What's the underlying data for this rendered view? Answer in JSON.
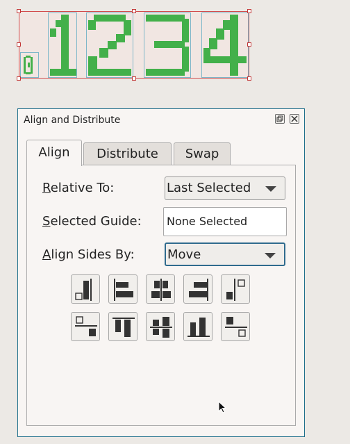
{
  "canvas": {
    "digits": [
      "0",
      "1",
      "2",
      "3",
      "4"
    ],
    "digit_color": "#43b04a"
  },
  "dialog": {
    "title": "Align and Distribute",
    "restore_icon": "restore-icon",
    "close_icon": "close-icon",
    "tabs": [
      {
        "label": "Align",
        "active": true
      },
      {
        "label": "Distribute",
        "active": false
      },
      {
        "label": "Swap",
        "active": false
      }
    ],
    "relative_to": {
      "mnemonic": "R",
      "label_rest": "elative To:",
      "value": "Last Selected"
    },
    "selected_guide": {
      "mnemonic": "S",
      "label_rest": "elected Guide:",
      "value": "None Selected"
    },
    "align_sides_by": {
      "mnemonic": "A",
      "label_rest": "lign Sides By:",
      "value": "Move"
    },
    "align_buttons": [
      "align-right-of-anchor-icon",
      "align-left-edges-icon",
      "center-horizontally-icon",
      "align-right-edges-icon",
      "align-left-of-anchor-icon",
      "align-below-anchor-icon",
      "align-top-edges-icon",
      "center-vertically-icon",
      "align-bottom-edges-icon",
      "align-above-anchor-icon"
    ]
  }
}
